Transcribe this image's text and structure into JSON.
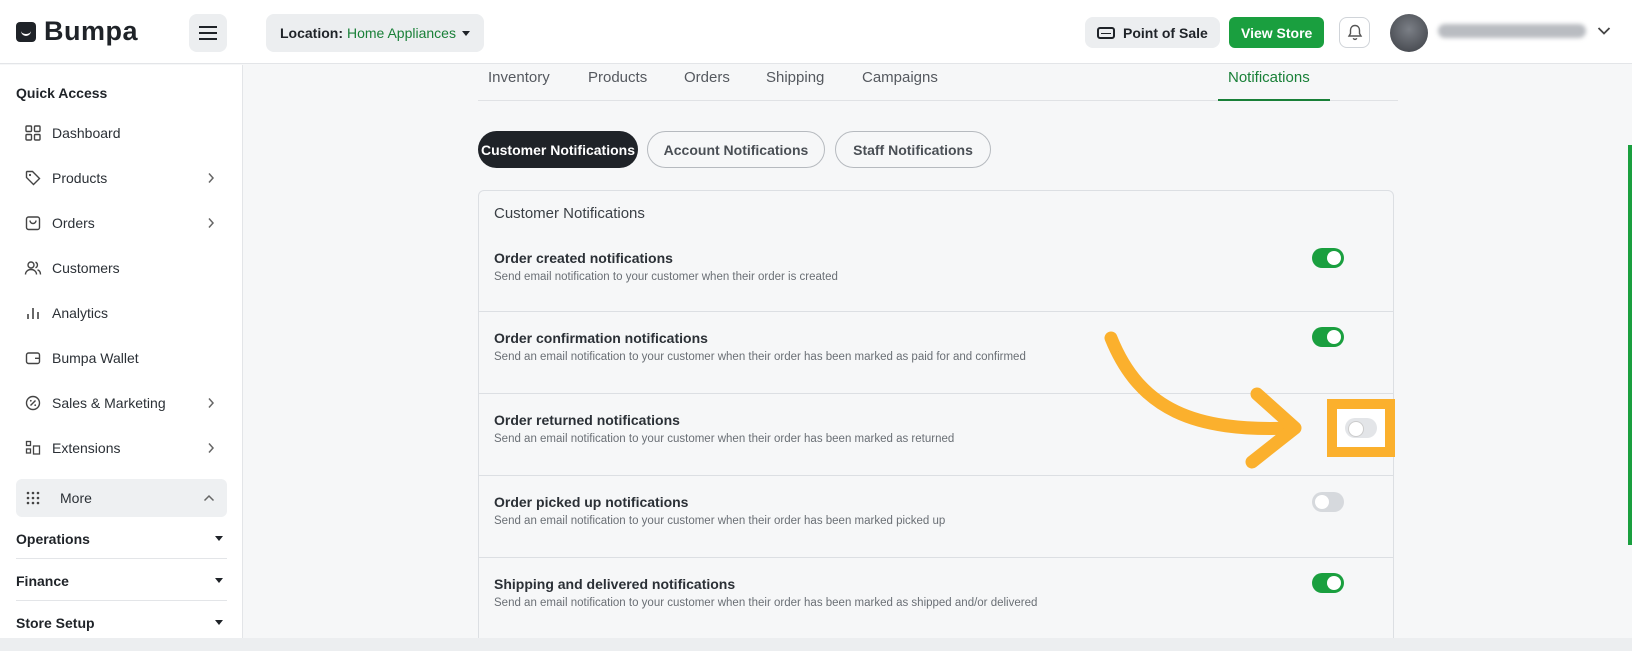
{
  "header": {
    "logo_text": "Bumpa",
    "location_label": "Location:",
    "location_value": "Home Appliances",
    "pos_label": "Point of Sale",
    "view_store_label": "View Store"
  },
  "sidebar": {
    "quick_access_title": "Quick Access",
    "items": [
      {
        "label": "Dashboard",
        "icon": "dashboard-icon"
      },
      {
        "label": "Products",
        "icon": "tag-icon"
      },
      {
        "label": "Orders",
        "icon": "bag-icon"
      },
      {
        "label": "Customers",
        "icon": "users-icon"
      },
      {
        "label": "Analytics",
        "icon": "bar-chart-icon"
      },
      {
        "label": "Bumpa Wallet",
        "icon": "wallet-icon"
      },
      {
        "label": "Sales & Marketing",
        "icon": "percent-icon"
      },
      {
        "label": "Extensions",
        "icon": "extensions-icon"
      },
      {
        "label": "More",
        "icon": "grid-dots-icon"
      }
    ],
    "groups": [
      "Operations",
      "Finance",
      "Store Setup"
    ]
  },
  "tabs": [
    "Inventory",
    "Products",
    "Orders",
    "Shipping",
    "Campaigns",
    "Notifications"
  ],
  "active_tab": "Notifications",
  "pills": [
    "Customer Notifications",
    "Account Notifications",
    "Staff Notifications"
  ],
  "active_pill": "Customer Notifications",
  "card": {
    "title": "Customer Notifications",
    "rows": [
      {
        "title": "Order created notifications",
        "desc": "Send email notification to your customer when their order is created",
        "enabled": true
      },
      {
        "title": "Order confirmation notifications",
        "desc": "Send an email notification to your customer when their order has been marked as paid for and confirmed",
        "enabled": true
      },
      {
        "title": "Order returned notifications",
        "desc": "Send an email notification to your customer when their order has been marked as returned",
        "enabled": false
      },
      {
        "title": "Order picked up notifications",
        "desc": "Send an email notification to your customer when their order has been marked picked up",
        "enabled": false
      },
      {
        "title": "Shipping and delivered notifications",
        "desc": "Send an email notification to your customer when their order has been marked as shipped and/or delivered",
        "enabled": true
      }
    ]
  },
  "colors": {
    "brand_green": "#1a9f3f",
    "highlight_orange": "#fbb02d"
  }
}
